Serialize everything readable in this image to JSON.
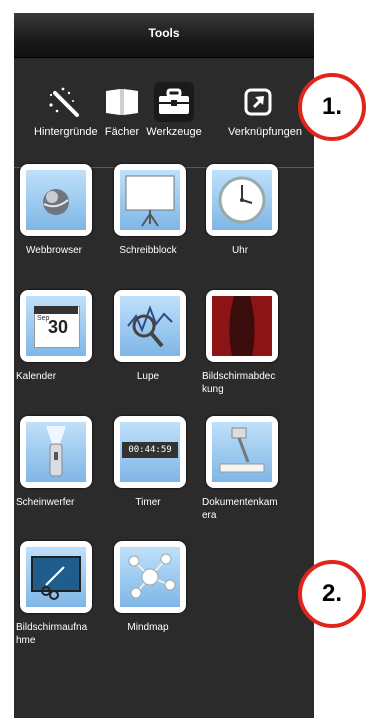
{
  "window": {
    "title": "Tools"
  },
  "tabs": [
    {
      "label": "Hintergründe",
      "icon": "magic-wand-icon",
      "active": false
    },
    {
      "label": "Fächer",
      "icon": "book-icon",
      "active": false
    },
    {
      "label": "Werkzeuge",
      "icon": "toolbox-icon",
      "active": true
    },
    {
      "label": "Verknüpfungen",
      "icon": "shortcut-arrow-icon",
      "active": false
    }
  ],
  "tools": [
    {
      "label": "Webbrowser",
      "icon": "globe-icon"
    },
    {
      "label": "Schreibblock",
      "icon": "whiteboard-icon"
    },
    {
      "label": "Uhr",
      "icon": "clock-icon"
    },
    {
      "label": "Kalender",
      "icon": "calendar-icon",
      "calendar_month": "Sep",
      "calendar_day": "30"
    },
    {
      "label": "Lupe",
      "icon": "magnifier-icon"
    },
    {
      "label": "Bildschirmabdeckung",
      "icon": "curtain-icon"
    },
    {
      "label": "Scheinwerfer",
      "icon": "flashlight-icon"
    },
    {
      "label": "Timer",
      "icon": "timer-icon",
      "timer_digits": "00:44:59"
    },
    {
      "label": "Dokumentenkamera",
      "icon": "document-camera-icon"
    },
    {
      "label": "Bildschirmaufnahme",
      "icon": "screen-capture-icon"
    },
    {
      "label": "Mindmap",
      "icon": "mindmap-icon"
    }
  ],
  "callouts": [
    "1.",
    "2."
  ],
  "colors": {
    "panel": "#2b2b2b",
    "callout_ring": "#e0261c",
    "tile_bg": "#ffffff"
  }
}
